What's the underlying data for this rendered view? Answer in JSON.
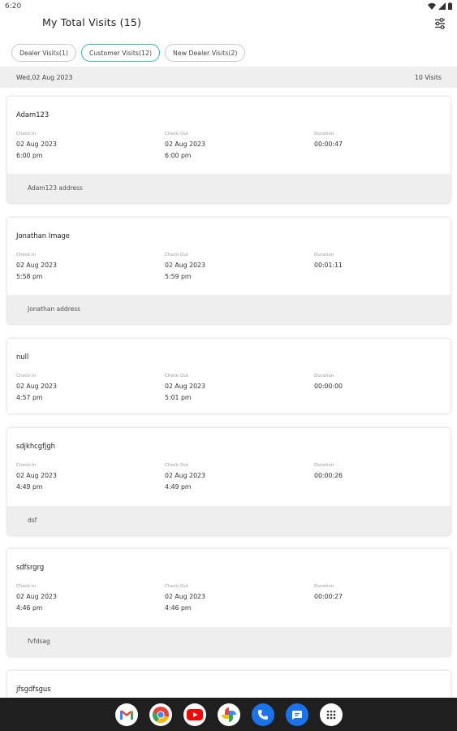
{
  "status": {
    "time": "6:20"
  },
  "header": {
    "title": "My Total Visits (15)"
  },
  "chips": [
    {
      "label": "Dealer Visits(1)"
    },
    {
      "label": "Customer Visits(12)"
    },
    {
      "label": "New Dealer Visits(2)"
    }
  ],
  "date_group": {
    "date": "Wed,02 Aug 2023",
    "count": "10 Visits"
  },
  "labels": {
    "check_in": "Check In",
    "check_out": "Check Out",
    "duration": "Duration"
  },
  "visits": [
    {
      "name": "Adam123",
      "in_date": "02 Aug 2023",
      "in_time": "6:00 pm",
      "out_date": "02 Aug 2023",
      "out_time": "6:00 pm",
      "duration": "00:00:47",
      "address": "Adam123 address"
    },
    {
      "name": "Jonathan Image",
      "in_date": "02 Aug 2023",
      "in_time": "5:58 pm",
      "out_date": "02 Aug 2023",
      "out_time": "5:59 pm",
      "duration": "00:01:11",
      "address": "Jonathan address"
    },
    {
      "name": "null",
      "in_date": "02 Aug 2023",
      "in_time": "4:57 pm",
      "out_date": "02 Aug 2023",
      "out_time": "5:01 pm",
      "duration": "00:00:00",
      "address": ""
    },
    {
      "name": "sdjkhcgfjgh",
      "in_date": "02 Aug 2023",
      "in_time": "4:49 pm",
      "out_date": "02 Aug 2023",
      "out_time": "4:49 pm",
      "duration": "00:00:26",
      "address": "dsf"
    },
    {
      "name": "sdfsrgrg",
      "in_date": "02 Aug 2023",
      "in_time": "4:46 pm",
      "out_date": "02 Aug 2023",
      "out_time": "4:46 pm",
      "duration": "00:00:27",
      "address": "fvfdsag"
    },
    {
      "name": "jfsgdfsgus"
    }
  ],
  "dock": [
    "gmail-icon",
    "chrome-icon",
    "youtube-icon",
    "photos-icon",
    "phone-icon",
    "messages-icon",
    "app-drawer-icon"
  ]
}
